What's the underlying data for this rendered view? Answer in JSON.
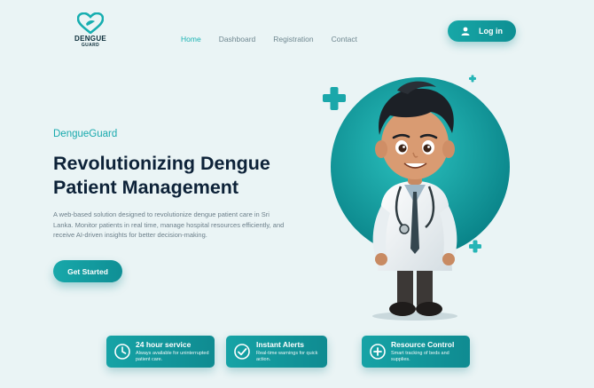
{
  "logo": {
    "title": "DENGUE",
    "subtitle": "GUARD"
  },
  "nav": {
    "items": [
      "Home",
      "Dashboard",
      "Registration",
      "Contact"
    ],
    "active": "Home"
  },
  "login": {
    "label": "Log in"
  },
  "hero": {
    "eyebrow": "DengueGuard",
    "headline": "Revolutionizing Dengue Patient Management",
    "description": "A web-based solution designed to revolutionize dengue patient care in Sri Lanka. Monitor patients in real time, manage hospital resources efficiently, and receive AI-driven insights for better decision-making.",
    "cta": "Get Started"
  },
  "features": [
    {
      "title": "24 hour service",
      "desc": "Always available for uninterrupted patient care.",
      "icon": "clock-icon"
    },
    {
      "title": "Instant Alerts",
      "desc": "Real-time warnings for quick action.",
      "icon": "check-circle-icon"
    },
    {
      "title": "Resource Control",
      "desc": "Smart tracking of beds and supplies.",
      "icon": "plus-circle-icon"
    }
  ],
  "colors": {
    "accent": "#16a3a6",
    "heading": "#0d2238",
    "background": "#eaf4f5"
  }
}
